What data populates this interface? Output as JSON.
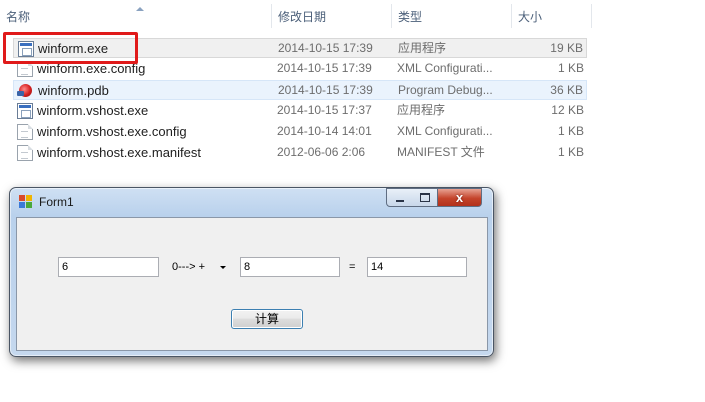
{
  "explorer": {
    "columns": {
      "name": "名称",
      "date": "修改日期",
      "type": "类型",
      "size": "大小"
    },
    "files": [
      {
        "name": "winform.exe",
        "date": "2014-10-15 17:39",
        "type": "应用程序",
        "size": "19 KB",
        "icon": "exe-icon"
      },
      {
        "name": "winform.exe.config",
        "date": "2014-10-15 17:39",
        "type": "XML Configurati...",
        "size": "1 KB",
        "icon": "document-icon"
      },
      {
        "name": "winform.pdb",
        "date": "2014-10-15 17:39",
        "type": "Program Debug...",
        "size": "36 KB",
        "icon": "debug-database-icon"
      },
      {
        "name": "winform.vshost.exe",
        "date": "2014-10-15 17:37",
        "type": "应用程序",
        "size": "12 KB",
        "icon": "exe-icon"
      },
      {
        "name": "winform.vshost.exe.config",
        "date": "2014-10-14 14:01",
        "type": "XML Configurati...",
        "size": "1 KB",
        "icon": "document-icon"
      },
      {
        "name": "winform.vshost.exe.manifest",
        "date": "2012-06-06 2:06",
        "type": "MANIFEST 文件",
        "size": "1 KB",
        "icon": "document-icon"
      }
    ],
    "highlight_color": "#e01a1a",
    "selection_color": "#f0f0f0"
  },
  "form": {
    "title": "Form1",
    "close_glyph": "x",
    "operand1": "6",
    "operator": "0---> +",
    "operand2": "8",
    "equals": "=",
    "result": "14",
    "compute_button": "计算"
  }
}
